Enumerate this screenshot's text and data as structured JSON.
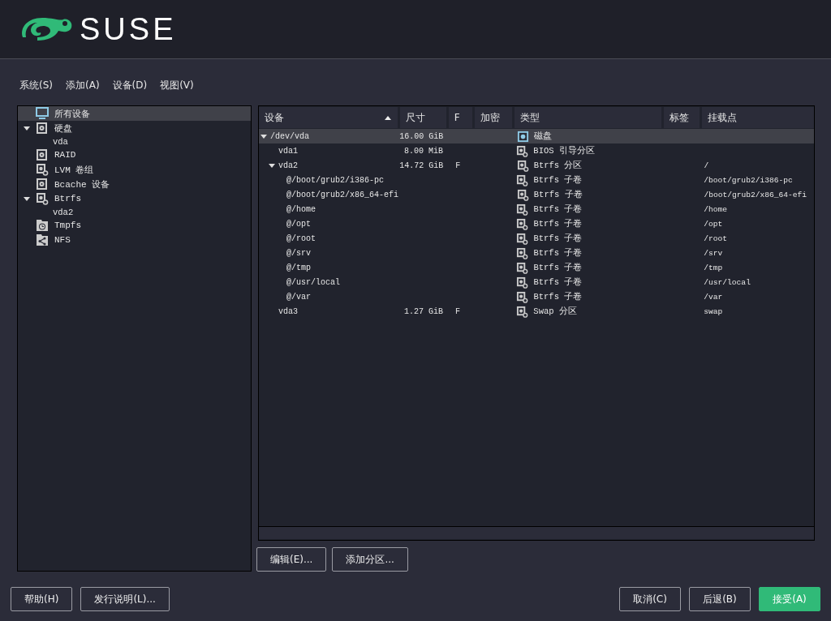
{
  "header": {
    "logo_text": "SUSE"
  },
  "menu": [
    "系统(S)",
    "添加(A)",
    "设备(D)",
    "视图(V)"
  ],
  "tree": [
    {
      "label": "所有设备",
      "kind": "monitor",
      "selected": true
    },
    {
      "label": "硬盘",
      "kind": "disk",
      "selected": false,
      "expanded": true,
      "children": [
        {
          "label": "vda",
          "selected": false
        }
      ]
    },
    {
      "label": "RAID",
      "kind": "disk",
      "selected": false
    },
    {
      "label": "LVM 卷组",
      "kind": "volume",
      "selected": false
    },
    {
      "label": "Bcache 设备",
      "kind": "disk",
      "selected": false
    },
    {
      "label": "Btrfs",
      "kind": "volume",
      "selected": false,
      "expanded": true,
      "children": [
        {
          "label": "vda2",
          "selected": false
        }
      ]
    },
    {
      "label": "Tmpfs",
      "kind": "clock-folder",
      "selected": false
    },
    {
      "label": "NFS",
      "kind": "share-folder",
      "selected": false
    }
  ],
  "table": {
    "columns": [
      {
        "label": "设备",
        "sorted": true
      },
      {
        "label": "尺寸",
        "sorted": false
      },
      {
        "label": "F",
        "sorted": false
      },
      {
        "label": "加密",
        "sorted": false
      },
      {
        "label": "类型",
        "sorted": false
      },
      {
        "label": "标签",
        "sorted": false
      },
      {
        "label": "挂载点",
        "sorted": false
      }
    ],
    "rows": [
      {
        "device": "/dev/vda",
        "size": "16.00 GiB",
        "kind": "disk",
        "type": "磁盘",
        "selected": true,
        "expanded": true,
        "children": [
          {
            "device": "vda1",
            "size": "8.00 MiB",
            "kind": "volume",
            "type": "BIOS 引导分区",
            "selected": false
          },
          {
            "device": "vda2",
            "size": "14.72 GiB",
            "f": "F",
            "kind": "volume",
            "type": "Btrfs 分区",
            "mount": "/",
            "selected": false,
            "expanded": true,
            "children": [
              {
                "device": "@/boot/grub2/i386-pc",
                "kind": "volume",
                "type": "Btrfs 子卷",
                "mount": "/boot/grub2/i386-pc",
                "selected": false
              },
              {
                "device": "@/boot/grub2/x86_64-efi",
                "kind": "volume",
                "type": "Btrfs 子卷",
                "mount": "/boot/grub2/x86_64-efi",
                "selected": false
              },
              {
                "device": "@/home",
                "kind": "volume",
                "type": "Btrfs 子卷",
                "mount": "/home",
                "selected": false
              },
              {
                "device": "@/opt",
                "kind": "volume",
                "type": "Btrfs 子卷",
                "mount": "/opt",
                "selected": false
              },
              {
                "device": "@/root",
                "kind": "volume",
                "type": "Btrfs 子卷",
                "mount": "/root",
                "selected": false
              },
              {
                "device": "@/srv",
                "kind": "volume",
                "type": "Btrfs 子卷",
                "mount": "/srv",
                "selected": false
              },
              {
                "device": "@/tmp",
                "kind": "volume",
                "type": "Btrfs 子卷",
                "mount": "/tmp",
                "selected": false
              },
              {
                "device": "@/usr/local",
                "kind": "volume",
                "type": "Btrfs 子卷",
                "mount": "/usr/local",
                "selected": false
              },
              {
                "device": "@/var",
                "kind": "volume",
                "type": "Btrfs 子卷",
                "mount": "/var",
                "selected": false
              }
            ]
          },
          {
            "device": "vda3",
            "size": "1.27 GiB",
            "f": "F",
            "kind": "volume",
            "type": "Swap 分区",
            "mount": "swap",
            "selected": false
          }
        ]
      }
    ]
  },
  "table_buttons": [
    "编辑(E)...",
    "添加分区..."
  ],
  "footer_left": [
    "帮助(H)",
    "发行说明(L)..."
  ],
  "footer_right": [
    {
      "label": "取消(C)",
      "primary": false
    },
    {
      "label": "后退(B)",
      "primary": false
    },
    {
      "label": "接受(A)",
      "primary": true
    }
  ]
}
